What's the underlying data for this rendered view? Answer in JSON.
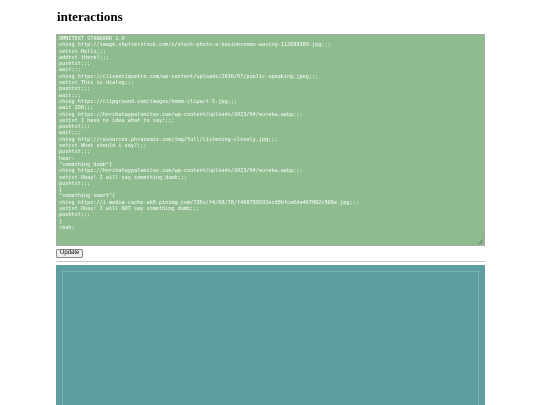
{
  "page": {
    "title": "interactions"
  },
  "editor": {
    "content": "OMNITEXT STANDARD 1.0\nching http://image.shutterstock.com/z/stock-photo-a-businessman-waving-112689389.jpg;;;\nsettxt Hello;;;\naddtxt there!;;;\npushtxt;;;\nwait;;;\nching https://cliseetiquette.com/wp-content/uploads/2016/07/public-speaking.jpeg;;;\nsettxt This is dialog;;;\npushtxt;;;\nwait;;;\nching https://clipground.com/images/hmmm-clipart-5.jpg;;;\nwait 200;;;\nching https://horchataypalomitas.com/wp-content/uploads/2023/04/eureka.webp;;;\nsettxt I have no idea what to say!;;;\npushtxt;;;\nwait;;;\nching http://resources.phrasemix.com/img/full/listening-closely.jpg;;;\nsettxt What should i say?;;;\npushtxt;;;\nhear:\n\"something dumb\"{\nching https://horchataypalomitas.com/wp-content/uploads/2023/04/eureka.webp;;;\nsettxt Okay! I will say something dumb;;;\npushtxt;;;\n}\n\"something smart\"{\nching https://i-media-cache-ak0.pinimg.com/736x/f4/68/78/f468789592ecd0bfce6da467082c908e.jpg;;;\nsettxt Okay! I will NOT say something dumb;;;\npushtxt;;;\n}\nreah;"
  },
  "controls": {
    "update_label": "Update"
  },
  "colors": {
    "editor_background": "#8fbc8f",
    "editor_text": "#ffffff",
    "canvas_background": "#5f9ea0"
  }
}
